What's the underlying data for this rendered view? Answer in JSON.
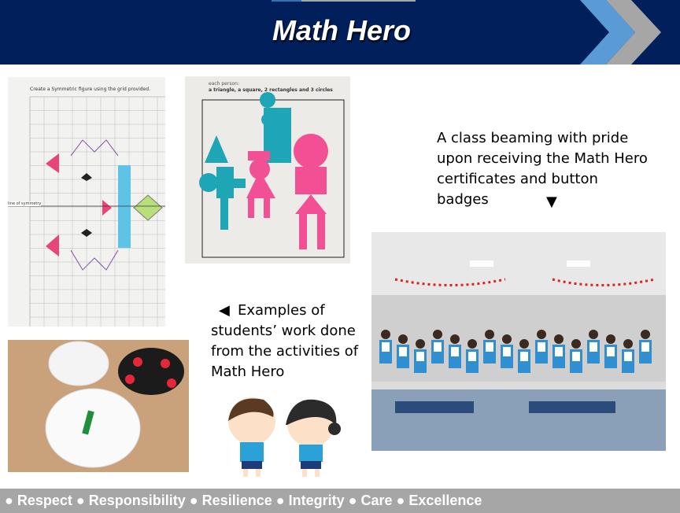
{
  "header": {
    "title": "Math Hero",
    "colors": {
      "band": "#001f5b",
      "chevron_blue": "#5b9bd5",
      "chevron_grey": "#a6a6a6"
    }
  },
  "captions": {
    "class_photo": "A class beaming with pride upon receiving the Math Hero certificates and button badges",
    "class_arrow": "▼",
    "work_arrow": "◀",
    "work": "Examples of students’ work done from the activities of Math Hero"
  },
  "photos": {
    "worksheet_symmetry": {
      "instruction": "Create a Symmetric figure using the grid provided.",
      "label": "line of symmetry"
    },
    "worksheet_shapes": {
      "instruction": "a triangle, a square, 2 rectangles and 3 circles",
      "sub": "each person:"
    }
  },
  "footer": {
    "values": "● Respect ● Responsibility ● Resilience ● Integrity ● Care ● Excellence"
  }
}
